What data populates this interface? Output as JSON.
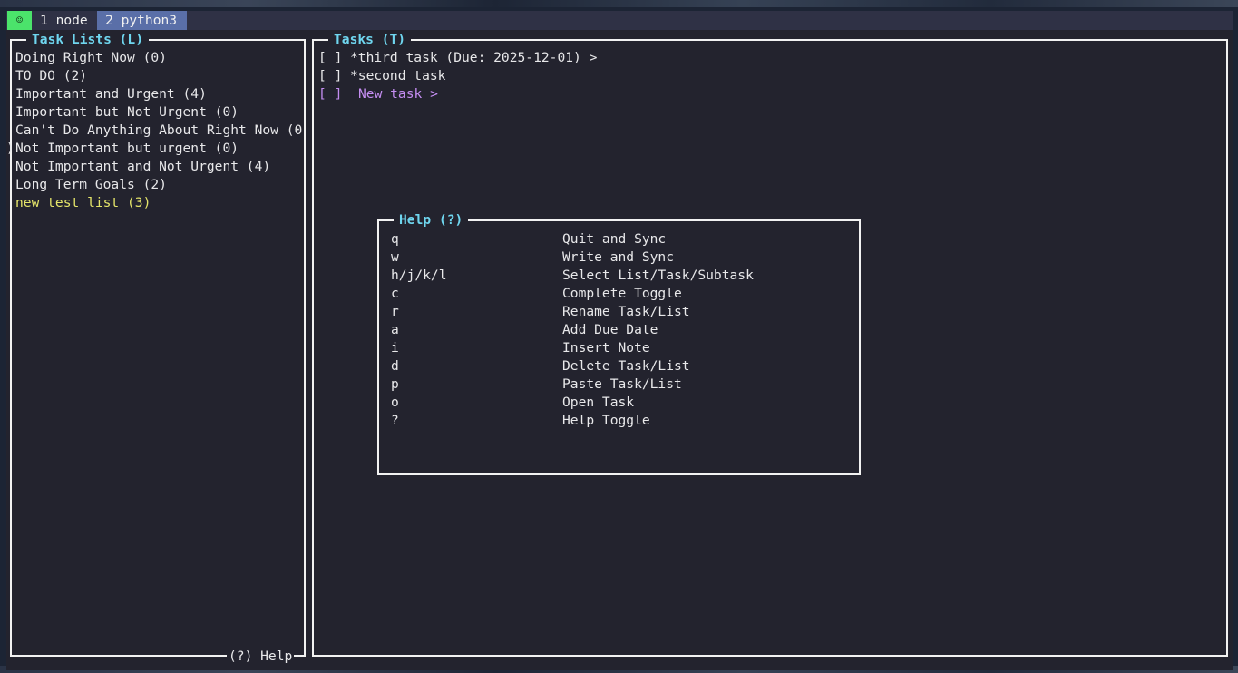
{
  "colors": {
    "background": "#23232e",
    "border": "#f2f2f2",
    "title": "#6fd6ef",
    "selected_list": "#e5e56a",
    "new_task": "#c48df1",
    "status_tab": "#4be36b",
    "active_tab": "#5a6fa8"
  },
  "tabbar": {
    "status_icon": "☺",
    "tabs": [
      {
        "label": "1 node"
      },
      {
        "label": "2 python3"
      }
    ]
  },
  "lists_panel": {
    "title": "Task Lists (L)",
    "items": [
      {
        "label": "Doing Right Now (0)"
      },
      {
        "label": "TO DO (2)"
      },
      {
        "label": "Important and Urgent (4)"
      },
      {
        "label": "Important but Not Urgent (0)"
      },
      {
        "label": "Can't Do Anything About Right Now (0"
      },
      {
        "label": "Not Important but urgent (0)"
      },
      {
        "label": "Not Important and Not Urgent (4)"
      },
      {
        "label": "Long Term Goals (2)"
      },
      {
        "label": "new test list (3)"
      }
    ],
    "wrap_char": ")",
    "footer": "(?) Help"
  },
  "tasks_panel": {
    "title": "Tasks (T)",
    "items": [
      {
        "checkbox": "[ ]",
        "label": "*third task (Due: 2025-12-01) >"
      },
      {
        "checkbox": "[ ]",
        "label": "*second task"
      }
    ],
    "new_task": {
      "checkbox": "[ ]",
      "label": "New task >"
    }
  },
  "help_dialog": {
    "title": "Help (?)",
    "rows": [
      {
        "key": "q",
        "desc": "Quit and Sync"
      },
      {
        "key": "w",
        "desc": "Write and Sync"
      },
      {
        "key": "h/j/k/l",
        "desc": "Select List/Task/Subtask"
      },
      {
        "key": "c",
        "desc": "Complete Toggle"
      },
      {
        "key": "r",
        "desc": "Rename Task/List"
      },
      {
        "key": "a",
        "desc": "Add Due Date"
      },
      {
        "key": "i",
        "desc": "Insert Note"
      },
      {
        "key": "d",
        "desc": "Delete Task/List"
      },
      {
        "key": "p",
        "desc": "Paste Task/List"
      },
      {
        "key": "o",
        "desc": "Open Task"
      },
      {
        "key": "?",
        "desc": "Help Toggle"
      }
    ]
  }
}
